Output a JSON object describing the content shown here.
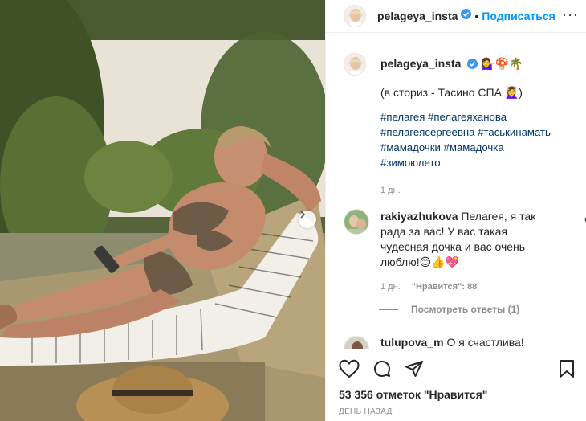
{
  "header": {
    "username": "pelageya_insta",
    "separator": "•",
    "follow_label": "Подписаться",
    "more_label": "···"
  },
  "caption": {
    "username": "pelageya_insta",
    "emojis": "💁‍♀️🍄🌴",
    "text": "(в сториз - Тасино СПА 💆‍♀️)",
    "hashtags": [
      "#пелагея #пелагеяханова",
      "#пелагеясергеевна #таськинамать",
      "#мамадочки #мамадочка",
      "#зимоюлето"
    ],
    "time": "1 дн."
  },
  "comment": {
    "username": "rakiyazhukova",
    "lines": [
      "Пелагея, я так",
      "рада за вас! У вас такая",
      "чудесная дочка и вас очень",
      "люблю!😊👍💖"
    ],
    "time": "1 дн.",
    "likes": "\"Нравится\": 88",
    "view_replies": "Посмотреть ответы (1)"
  },
  "next_comment": {
    "username": "tulupova_m",
    "text": "О я счастлива!"
  },
  "actions": {
    "likes": "53 356 отметок \"Нравится\"",
    "date": "ДЕНЬ НАЗАД"
  },
  "colors": {
    "link_blue": "#0095f6",
    "hashtag": "#00376b",
    "muted": "#8e8e8e",
    "text": "#262626"
  }
}
